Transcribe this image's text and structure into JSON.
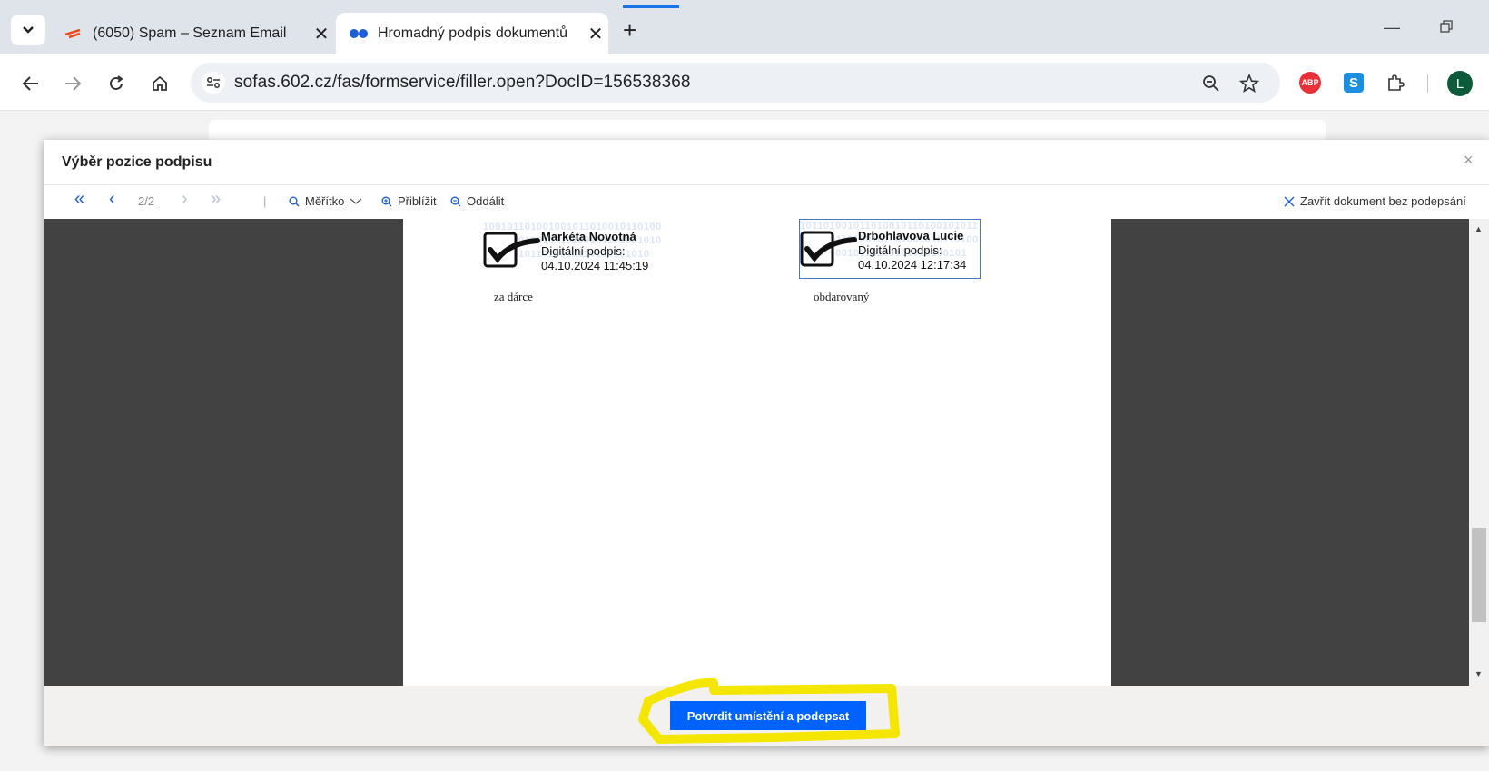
{
  "browser": {
    "tabs": [
      {
        "title": "(6050) Spam – Seznam Email",
        "active": false
      },
      {
        "title": "Hromadný podpis dokumentů",
        "active": true
      }
    ],
    "url": "sofas.602.cz/fas/formservice/filler.open?DocID=156538368",
    "profile_initial": "L",
    "abp_label": "ABP",
    "s_label": "S"
  },
  "dialog": {
    "title": "Výběr pozice podpisu",
    "close_symbol": "×",
    "toolbar": {
      "page_indicator": "2/2",
      "scale_label": "Měřítko",
      "zoom_in_label": "Přiblížit",
      "zoom_out_label": "Oddálit",
      "close_without_signing": "Zavřít dokument bez podepsání"
    },
    "signatures": [
      {
        "name": "Markéta Novotná",
        "line2": "Digitální podpis:",
        "timestamp": "04.10.2024 11:45:19",
        "caption": "za dárce",
        "selected": false
      },
      {
        "name": "Drbohlavova Lucie",
        "line2": "Digitální podpis:",
        "timestamp": "04.10.2024 12:17:34",
        "caption": "obdarovaný",
        "selected": true
      }
    ],
    "confirm_button": "Potvrdit umístění a podepsat"
  },
  "colors": {
    "accent": "#0062ff",
    "highlight": "#f5e600",
    "viewer_background": "#424242"
  }
}
